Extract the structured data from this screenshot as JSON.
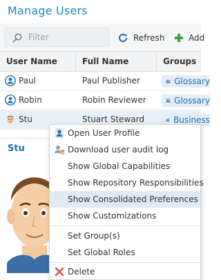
{
  "title": "Manage Users",
  "toolbar": {
    "filter_placeholder": "Filter",
    "refresh_label": "Refresh",
    "add_label": "Add"
  },
  "grid": {
    "columns": [
      "User Name",
      "Full Name",
      "Groups"
    ],
    "rows": [
      {
        "username": "Paul",
        "fullname": "Paul Publisher",
        "group": "Glossary"
      },
      {
        "username": "Robin",
        "fullname": "Robin Reviewer",
        "group": "Glossary"
      },
      {
        "username": "Stu",
        "fullname": "Stuart Steward",
        "group": "Business"
      }
    ]
  },
  "detail": {
    "name": "Stu"
  },
  "context_menu": {
    "items": [
      {
        "label": "Open User Profile",
        "icon": "user-profile-icon"
      },
      {
        "label": "Download user audit log",
        "icon": "download-audit-icon"
      },
      {
        "label": "Show Global Capabilities"
      },
      {
        "label": "Show Repository Responsibilities"
      },
      {
        "label": "Show Consolidated Preferences"
      },
      {
        "label": "Show Customizations"
      },
      {
        "label": "Set Group(s)"
      },
      {
        "label": "Set Global Roles"
      },
      {
        "label": "Delete",
        "icon": "delete-x-icon"
      }
    ],
    "highlighted": "Show Consolidated Preferences"
  },
  "colors": {
    "accent": "#1e88b8",
    "link_blue": "#1e6fb0",
    "selected_row": "#e8f1fa",
    "menu_highlight": "#dfeaf6",
    "delete_red": "#d9534f",
    "add_green": "#3aa53a"
  }
}
